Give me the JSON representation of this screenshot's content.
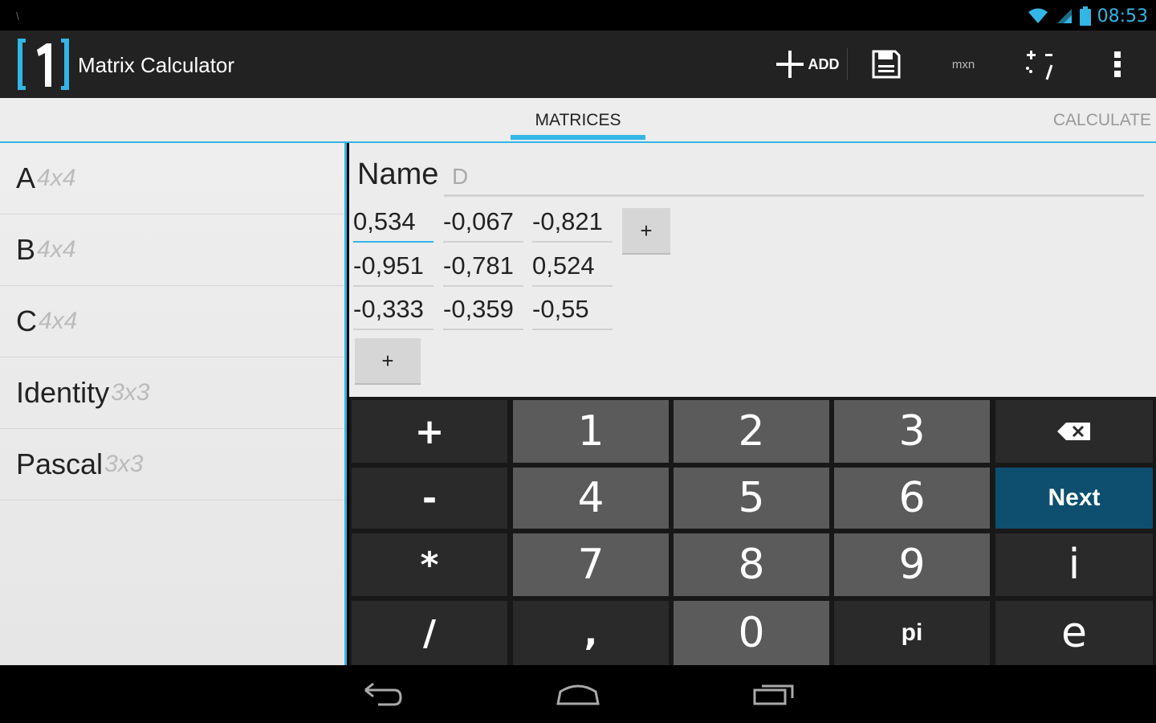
{
  "status": {
    "time": "08:53"
  },
  "app": {
    "title": "Matrix Calculator"
  },
  "actions": {
    "add_label": "ADD",
    "mxn_label": "mxn"
  },
  "tabs": {
    "matrices": "MATRICES",
    "calculate": "CALCULATE"
  },
  "matrix_list": [
    {
      "name": "A",
      "dim": "4x4"
    },
    {
      "name": "B",
      "dim": "4x4"
    },
    {
      "name": "C",
      "dim": "4x4"
    },
    {
      "name": "Identity",
      "dim": "3x3"
    },
    {
      "name": "Pascal",
      "dim": "3x3"
    }
  ],
  "editor": {
    "name_label": "Name",
    "name_value": "D",
    "add_col": "+",
    "add_row": "+",
    "rows": [
      [
        "0,534",
        "-0,067",
        "-0,821"
      ],
      [
        "-0,951",
        "-0,781",
        "0,524"
      ],
      [
        "-0,333",
        "-0,359",
        "-0,55"
      ]
    ]
  },
  "keypad": {
    "row1": [
      "+",
      "1",
      "2",
      "3"
    ],
    "row2": [
      "-",
      "4",
      "5",
      "6",
      "Next"
    ],
    "row3": [
      "*",
      "7",
      "8",
      "9",
      "i"
    ],
    "row4": [
      "/",
      ",",
      "0",
      "pi",
      "e"
    ]
  }
}
